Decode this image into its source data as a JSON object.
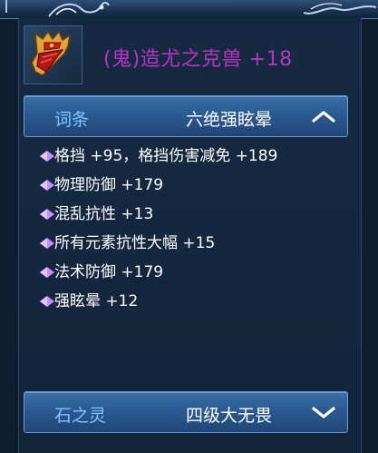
{
  "item": {
    "name": "(鬼)造尤之克兽 +18",
    "name_color": "#b535c2",
    "icon": "gauntlet-icon"
  },
  "entry_section": {
    "label": "词条",
    "value": "六绝强眩晕",
    "chevron": "chevron-up-icon",
    "expanded": true
  },
  "attributes": [
    {
      "text": "格挡 +95，格挡伤害减免 +189"
    },
    {
      "text": "物理防御 +179"
    },
    {
      "text": "混乱抗性 +13"
    },
    {
      "text": "所有元素抗性大幅 +15"
    },
    {
      "text": "法术防御 +179"
    },
    {
      "text": "强眩晕 +12"
    }
  ],
  "spirit_section": {
    "label": "石之灵",
    "value": "四级大无畏",
    "chevron": "chevron-down-icon",
    "expanded": false
  },
  "colors": {
    "label_blue": "#7fc3ff",
    "value_white": "#ffffff",
    "gem_purple": "#c58cff"
  }
}
